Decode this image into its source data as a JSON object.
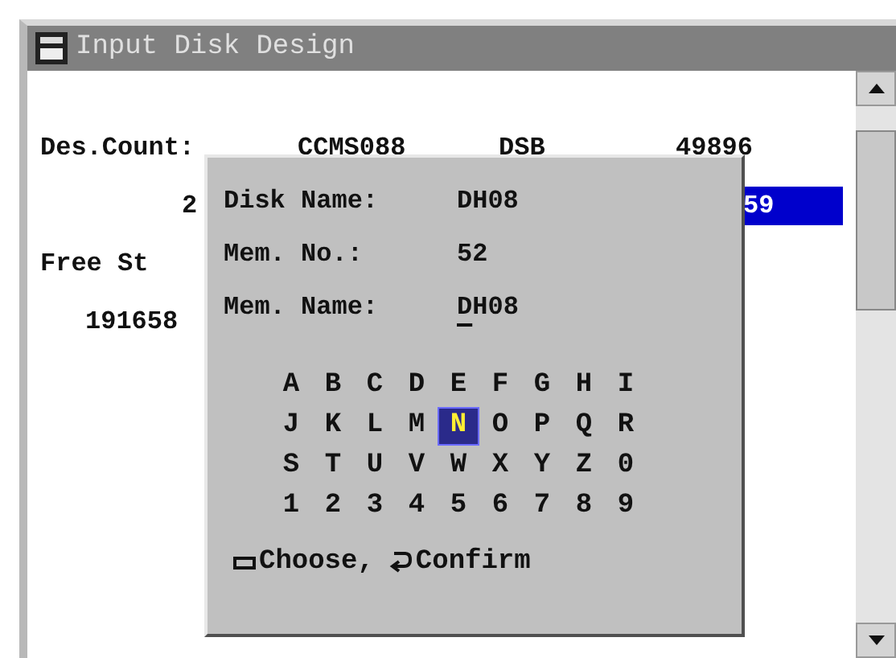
{
  "window": {
    "title": "Input Disk Design"
  },
  "background_rows": [
    {
      "kind": "fields",
      "texts": [
        "Des.Count:",
        "CCMS088",
        "DSB",
        "49896"
      ]
    },
    {
      "kind": "partial",
      "texts": [
        "2"
      ],
      "highlight": "59"
    },
    {
      "kind": "label",
      "texts": [
        "Free St"
      ]
    },
    {
      "kind": "value",
      "texts": [
        "191658"
      ]
    }
  ],
  "dialog": {
    "fields": [
      {
        "label": "Disk Name:",
        "value": "DH08",
        "cursor_at_start": false
      },
      {
        "label": "Mem. No.:",
        "value": "52",
        "cursor_at_start": false
      },
      {
        "label": "Mem. Name:",
        "value": "DH08",
        "cursor_at_start": true
      }
    ],
    "keys": [
      [
        {
          "char": "A",
          "selected": false
        },
        {
          "char": "B",
          "selected": false
        },
        {
          "char": "C",
          "selected": false
        },
        {
          "char": "D",
          "selected": false
        },
        {
          "char": "E",
          "selected": false
        },
        {
          "char": "F",
          "selected": false
        },
        {
          "char": "G",
          "selected": false
        },
        {
          "char": "H",
          "selected": false
        },
        {
          "char": "I",
          "selected": false
        }
      ],
      [
        {
          "char": "J",
          "selected": false
        },
        {
          "char": "K",
          "selected": false
        },
        {
          "char": "L",
          "selected": false
        },
        {
          "char": "M",
          "selected": false
        },
        {
          "char": "N",
          "selected": true
        },
        {
          "char": "O",
          "selected": false
        },
        {
          "char": "P",
          "selected": false
        },
        {
          "char": "Q",
          "selected": false
        },
        {
          "char": "R",
          "selected": false
        }
      ],
      [
        {
          "char": "S",
          "selected": false
        },
        {
          "char": "T",
          "selected": false
        },
        {
          "char": "U",
          "selected": false
        },
        {
          "char": "V",
          "selected": false
        },
        {
          "char": "W",
          "selected": false
        },
        {
          "char": "X",
          "selected": false
        },
        {
          "char": "Y",
          "selected": false
        },
        {
          "char": "Z",
          "selected": false
        },
        {
          "char": "0",
          "selected": false
        }
      ],
      [
        {
          "char": "1",
          "selected": false
        },
        {
          "char": "2",
          "selected": false
        },
        {
          "char": "3",
          "selected": false
        },
        {
          "char": "4",
          "selected": false
        },
        {
          "char": "5",
          "selected": false
        },
        {
          "char": "6",
          "selected": false
        },
        {
          "char": "7",
          "selected": false
        },
        {
          "char": "8",
          "selected": false
        },
        {
          "char": "9",
          "selected": false
        }
      ]
    ],
    "hints": [
      {
        "kind": "key",
        "text": "Choose,"
      },
      {
        "kind": "enter",
        "text": "Confirm"
      }
    ]
  }
}
